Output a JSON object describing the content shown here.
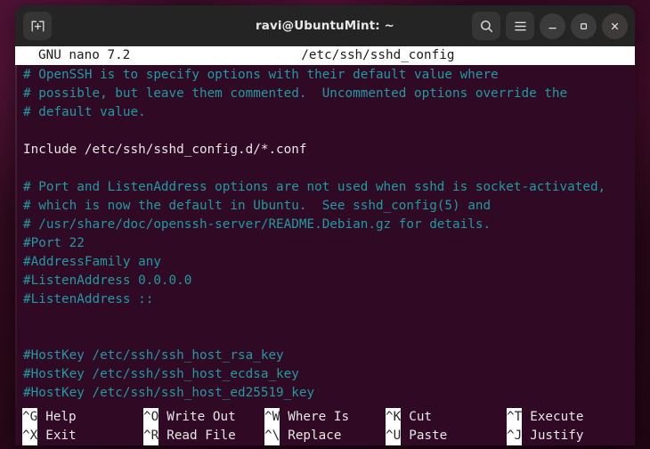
{
  "window": {
    "title": "ravi@UbuntuMint: ~",
    "new_tab_icon": "new-tab-icon",
    "search_icon": "search-icon",
    "menu_icon": "hamburger-menu-icon",
    "minimize_icon": "minimize-icon",
    "maximize_icon": "maximize-icon",
    "close_icon": "close-icon",
    "chrome_color": "#242424",
    "terminal_bg": "#300a24"
  },
  "nano": {
    "header": {
      "version": "GNU nano 7.2",
      "filename": "/etc/ssh/sshd_config"
    },
    "colors": {
      "comment": "#1f9ba3",
      "text": "#e6e6e6",
      "header_bg": "#ffffff",
      "header_fg": "#1b1b1b"
    },
    "lines": [
      {
        "kind": "comment",
        "text": "# OpenSSH is to specify options with their default value where"
      },
      {
        "kind": "comment",
        "text": "# possible, but leave them commented.  Uncommented options override the"
      },
      {
        "kind": "comment",
        "text": "# default value."
      },
      {
        "kind": "blank",
        "text": ""
      },
      {
        "kind": "text",
        "text": "Include /etc/ssh/sshd_config.d/*.conf"
      },
      {
        "kind": "blank",
        "text": ""
      },
      {
        "kind": "comment",
        "text": "# Port and ListenAddress options are not used when sshd is socket-activated,"
      },
      {
        "kind": "comment",
        "text": "# which is now the default in Ubuntu.  See sshd_config(5) and"
      },
      {
        "kind": "comment",
        "text": "# /usr/share/doc/openssh-server/README.Debian.gz for details."
      },
      {
        "kind": "comment",
        "text": "#Port 22"
      },
      {
        "kind": "comment",
        "text": "#AddressFamily any"
      },
      {
        "kind": "comment",
        "text": "#ListenAddress 0.0.0.0"
      },
      {
        "kind": "comment",
        "text": "#ListenAddress ::"
      },
      {
        "kind": "blank",
        "text": ""
      },
      {
        "kind": "blank",
        "text": ""
      },
      {
        "kind": "comment",
        "text": "#HostKey /etc/ssh/ssh_host_rsa_key"
      },
      {
        "kind": "comment",
        "text": "#HostKey /etc/ssh/ssh_host_ecdsa_key"
      },
      {
        "kind": "comment",
        "text": "#HostKey /etc/ssh/ssh_host_ed25519_key"
      }
    ],
    "shortcuts": {
      "row1": [
        {
          "key": "^G",
          "label": "Help"
        },
        {
          "key": "^O",
          "label": "Write Out"
        },
        {
          "key": "^W",
          "label": "Where Is"
        },
        {
          "key": "^K",
          "label": "Cut"
        },
        {
          "key": "^T",
          "label": "Execute"
        }
      ],
      "row2": [
        {
          "key": "^X",
          "label": "Exit"
        },
        {
          "key": "^R",
          "label": "Read File"
        },
        {
          "key": "^\\",
          "label": "Replace"
        },
        {
          "key": "^U",
          "label": "Paste"
        },
        {
          "key": "^J",
          "label": "Justify"
        }
      ]
    }
  }
}
